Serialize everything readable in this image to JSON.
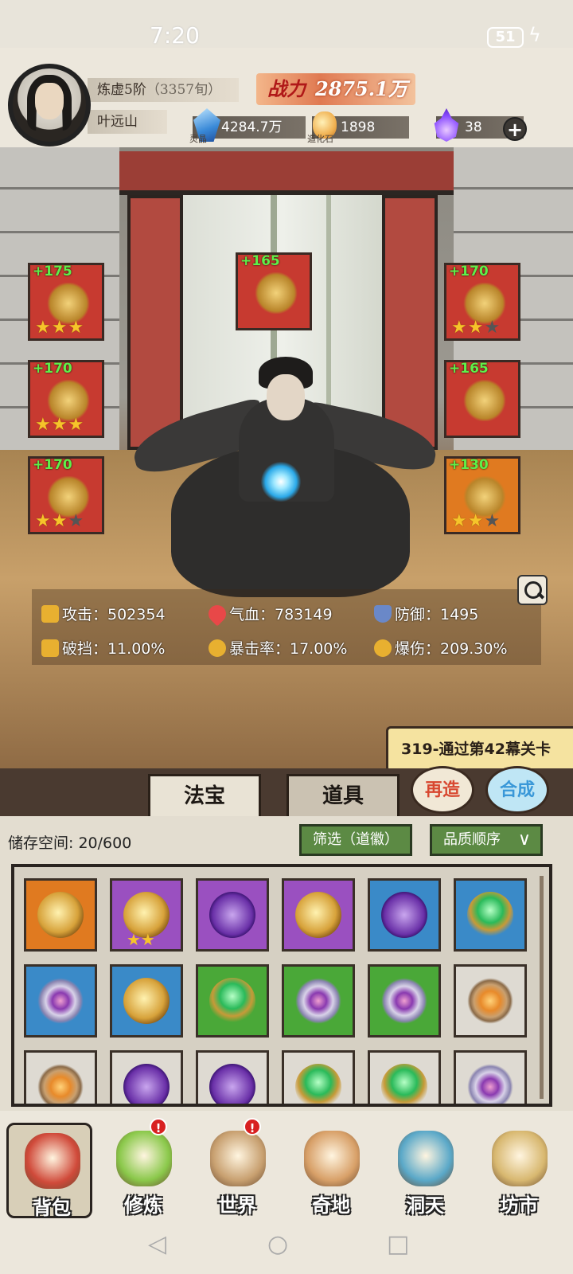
{
  "status_bar": {
    "time": "7:20",
    "battery": "51"
  },
  "player": {
    "realm": "炼虚5阶",
    "realm_extra": "（3357旬）",
    "name": "叶远山",
    "power_label": "战力",
    "power_value": "2875.1万"
  },
  "resources": [
    {
      "icon": "spirit-crystal-icon",
      "label": "灵晶",
      "value": "4284.7万"
    },
    {
      "icon": "creation-stone-icon",
      "label": "造化石",
      "value": "1898"
    },
    {
      "icon": "purple-flame-icon",
      "label": "",
      "value": "38"
    }
  ],
  "equipment": [
    {
      "slot": "left-1",
      "bonus": "+175",
      "stars": 3,
      "bg": "red"
    },
    {
      "slot": "left-2",
      "bonus": "+170",
      "stars": 3,
      "bg": "red"
    },
    {
      "slot": "left-3",
      "bonus": "+170",
      "stars": 2,
      "bg": "red"
    },
    {
      "slot": "center",
      "bonus": "+165",
      "stars": 0,
      "bg": "red"
    },
    {
      "slot": "right-1",
      "bonus": "+170",
      "stars": 2,
      "bg": "red"
    },
    {
      "slot": "right-2",
      "bonus": "+165",
      "stars": 0,
      "bg": "red"
    },
    {
      "slot": "right-3",
      "bonus": "+130",
      "stars": 2,
      "bg": "orange"
    }
  ],
  "stats": {
    "attack": "攻击：502354",
    "hp": "气血：783149",
    "defense": "防御：1495",
    "break": "破挡：11.00%",
    "crit_rate": "暴击率：17.00%",
    "crit_dmg": "爆伤：209.30%"
  },
  "quest": "319-通过第42幕关卡",
  "tabs": {
    "treasure": "法宝",
    "items": "道具",
    "reforge": "再造",
    "combine": "合成"
  },
  "storage": {
    "label": "储存空间: 20/600",
    "filter": "筛选（道徽）",
    "sort": "品质顺序"
  },
  "grid": [
    {
      "bg": "orange",
      "icon": "dragon-icon",
      "stars": 0
    },
    {
      "bg": "purple",
      "icon": "dragon-icon",
      "stars": 2
    },
    {
      "bg": "purple",
      "icon": "swirl-icon",
      "stars": 0
    },
    {
      "bg": "purple",
      "icon": "dragon-icon",
      "stars": 0
    },
    {
      "bg": "blue",
      "icon": "swirl-icon",
      "stars": 0
    },
    {
      "bg": "blue",
      "icon": "jade-crest-icon",
      "stars": 0
    },
    {
      "bg": "blue",
      "icon": "yin-yang-star-icon",
      "stars": 0
    },
    {
      "bg": "blue",
      "icon": "dragon-icon",
      "stars": 0
    },
    {
      "bg": "green",
      "icon": "jade-crest-icon",
      "stars": 0
    },
    {
      "bg": "green",
      "icon": "yin-yang-star-icon",
      "stars": 0
    },
    {
      "bg": "green",
      "icon": "yin-yang-star-icon",
      "stars": 0
    },
    {
      "bg": "white",
      "icon": "sun-compass-icon",
      "stars": 0
    },
    {
      "bg": "white",
      "icon": "sun-compass-icon",
      "stars": 0
    },
    {
      "bg": "white",
      "icon": "swirl-icon",
      "stars": 0
    },
    {
      "bg": "white",
      "icon": "swirl-icon",
      "stars": 0
    },
    {
      "bg": "white",
      "icon": "jade-crest-icon",
      "stars": 0
    },
    {
      "bg": "white",
      "icon": "jade-crest-icon",
      "stars": 0
    },
    {
      "bg": "white",
      "icon": "yin-yang-star-icon",
      "stars": 0
    }
  ],
  "nav": [
    {
      "label": "背包",
      "icon": "bag-icon",
      "alert": false
    },
    {
      "label": "修炼",
      "icon": "lotus-icon",
      "alert": true
    },
    {
      "label": "世界",
      "icon": "scroll-map-icon",
      "alert": true
    },
    {
      "label": "奇地",
      "icon": "floating-island-icon",
      "alert": false
    },
    {
      "label": "洞天",
      "icon": "portal-icon",
      "alert": false
    },
    {
      "label": "坊市",
      "icon": "market-stall-icon",
      "alert": false
    }
  ],
  "alert_mark": "!",
  "colors": {
    "power_bg": "#e07a52",
    "slot_red": "#c73a30",
    "slot_orange": "#e07a20",
    "filter_green": "#5c8a44",
    "bonus_green": "#5ef04a"
  }
}
